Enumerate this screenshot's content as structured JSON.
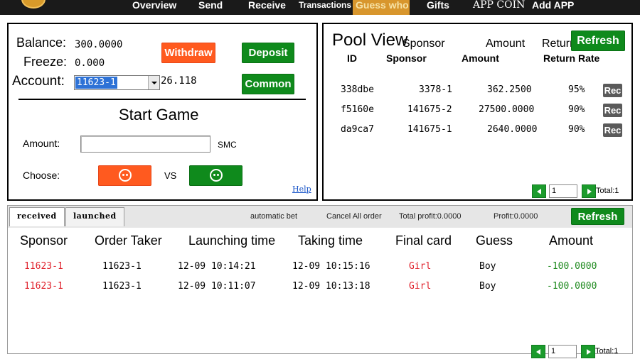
{
  "nav": {
    "items": [
      {
        "label": "Overview",
        "active": false
      },
      {
        "label": "Send",
        "active": false
      },
      {
        "label": "Receive",
        "active": false
      },
      {
        "label": "Transactions",
        "active": false
      },
      {
        "label": "Guess who",
        "active": true
      },
      {
        "label": "Gifts",
        "active": false
      },
      {
        "label": "APP COIN",
        "active": false
      },
      {
        "label": "Add APP",
        "active": false
      }
    ]
  },
  "game": {
    "balance_label": "Balance:",
    "balance_value": "300.0000",
    "freeze_label": "Freeze:",
    "freeze_value": "0.000",
    "account_label": "Account:",
    "account_selected": "11623-1",
    "account_extra": "26.118",
    "withdraw_label": "Withdraw",
    "deposit_label": "Deposit",
    "common_label": "Common",
    "title": "Start Game",
    "amount_label": "Amount:",
    "amount_value": "",
    "amount_unit": "SMC",
    "choose_label": "Choose:",
    "vs_label": "VS",
    "help_label": "Help"
  },
  "pool": {
    "title": "Pool View",
    "refresh_label": "Refresh",
    "overlap_headers": {
      "sponsor": "Sponsor",
      "amount": "Amount",
      "return_rate": "Return Rate"
    },
    "headers": {
      "id": "ID",
      "sponsor": "Sponsor",
      "amount": "Amount",
      "return_rate": "Return Rate"
    },
    "rows": [
      {
        "id": "338dbe",
        "sponsor": "3378-1",
        "amount": "362.2500",
        "rate": "95%",
        "action": "Rec"
      },
      {
        "id": "f5160e",
        "sponsor": "141675-2",
        "amount": "27500.0000",
        "rate": "90%",
        "action": "Rec"
      },
      {
        "id": "da9ca7",
        "sponsor": "141675-1",
        "amount": "2640.0000",
        "rate": "90%",
        "action": "Rec"
      }
    ],
    "pager": {
      "page": "1",
      "total": "Total:1"
    }
  },
  "orders": {
    "tabs": [
      {
        "label": "received",
        "active": true
      },
      {
        "label": "launched",
        "active": false
      }
    ],
    "automatic_bet": "automatic bet",
    "cancel_all": "Cancel All order",
    "total_profit": "Total profit:0.0000",
    "profit": "Profit:0.0000",
    "refresh_label": "Refresh",
    "columns": [
      "Sponsor",
      "Order Taker",
      "Launching time",
      "Taking time",
      "Final card",
      "Guess",
      "Amount"
    ],
    "rows": [
      {
        "sponsor": "11623-1",
        "taker": "11623-1",
        "launch": "12-09 10:14:21",
        "taking": "12-09 10:15:16",
        "final": "Girl",
        "guess": "Boy",
        "amount": "-100.0000"
      },
      {
        "sponsor": "11623-1",
        "taker": "11623-1",
        "launch": "12-09 10:11:07",
        "taking": "12-09 10:13:18",
        "final": "Girl",
        "guess": "Boy",
        "amount": "-100.0000"
      }
    ],
    "pager": {
      "page": "1",
      "total": "Total:1"
    }
  },
  "colors": {
    "nav_bg": "#1a1a1a",
    "nav_active": "#d8962d",
    "orange": "#ff5a1f",
    "green": "#0f8a1c",
    "red_text": "#e0222c",
    "green_text": "#1f8a1f"
  }
}
